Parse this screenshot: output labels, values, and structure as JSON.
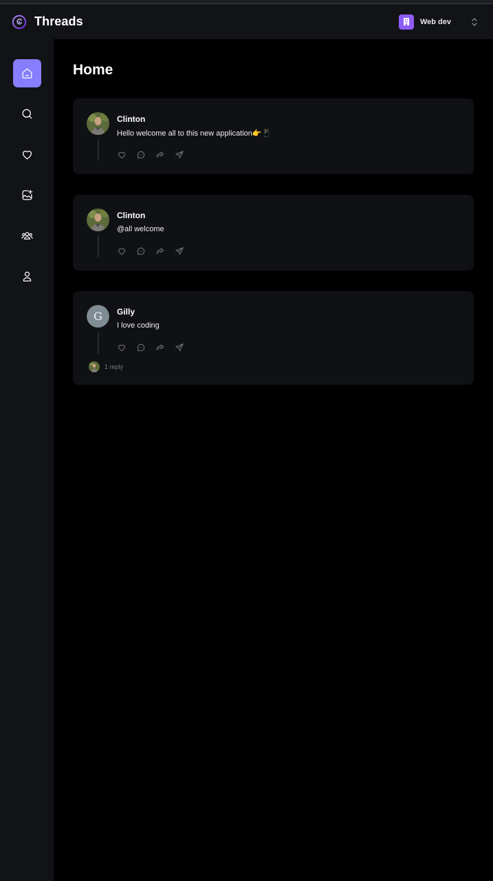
{
  "app": {
    "title": "Threads"
  },
  "org": {
    "name": "Web dev",
    "accent": "#8b5cf6"
  },
  "sidebar": {
    "accent": "#877eff",
    "items": [
      {
        "name": "home",
        "icon": "home-icon",
        "active": true
      },
      {
        "name": "search",
        "icon": "search-icon",
        "active": false
      },
      {
        "name": "activity",
        "icon": "heart-icon",
        "active": false
      },
      {
        "name": "create-thread",
        "icon": "image-plus-icon",
        "active": false
      },
      {
        "name": "communities",
        "icon": "users-icon",
        "active": false
      },
      {
        "name": "profile",
        "icon": "user-icon",
        "active": false
      }
    ]
  },
  "page": {
    "title": "Home"
  },
  "threads": [
    {
      "author": "Clinton",
      "text": "Hello welcome all to this new application👉📱",
      "avatar": "photo"
    },
    {
      "author": "Clinton",
      "text": "@all welcome",
      "avatar": "photo"
    },
    {
      "author": "Gilly",
      "text": "I love coding",
      "avatar": "letter",
      "avatar_letter": "G",
      "replies": "1 reply"
    }
  ],
  "actions": [
    "heart-icon",
    "reply-icon",
    "repost-icon",
    "share-icon"
  ]
}
